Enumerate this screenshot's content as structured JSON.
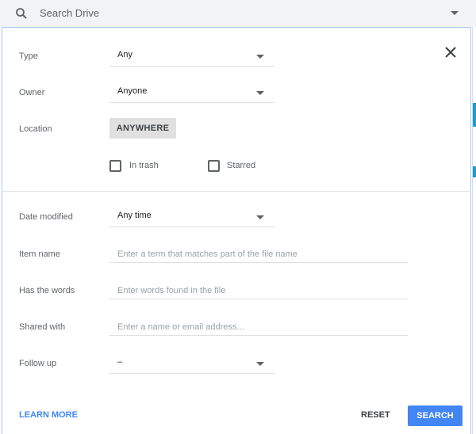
{
  "topbar": {
    "search_placeholder": "Search Drive",
    "search_icon": "search-icon",
    "options_icon": "caret-down-icon"
  },
  "dialog": {
    "close_icon": "close-icon",
    "type": {
      "label": "Type",
      "value": "Any"
    },
    "owner": {
      "label": "Owner",
      "value": "Anyone"
    },
    "location": {
      "label": "Location",
      "button_label": "ANYWHERE"
    },
    "checkboxes": [
      {
        "label": "In trash",
        "checked": false
      },
      {
        "label": "Starred",
        "checked": false
      }
    ],
    "date_modified": {
      "label": "Date modified",
      "value": "Any time"
    },
    "item_name": {
      "label": "Item name",
      "value": "",
      "placeholder": "Enter a term that matches part of the file name"
    },
    "has_words": {
      "label": "Has the words",
      "value": "",
      "placeholder": "Enter words found in the file"
    },
    "shared_with": {
      "label": "Shared with",
      "value": "",
      "placeholder": "Enter a name or email address..."
    },
    "follow_up": {
      "label": "Follow up",
      "value": "–"
    },
    "footer": {
      "learn_more": "LEARN MORE",
      "reset": "RESET",
      "search": "SEARCH"
    }
  },
  "colors": {
    "accent": "#4285f4",
    "panel_border": "#a8c7fa",
    "topbar_bg": "#f1f3f4"
  }
}
